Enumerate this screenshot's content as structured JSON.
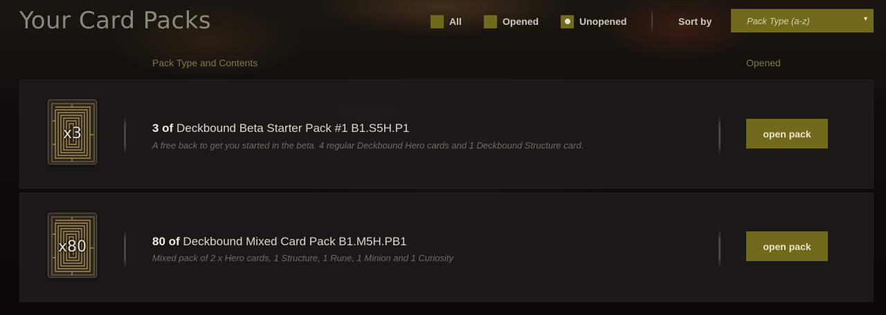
{
  "header": {
    "title": "Your Card Packs",
    "filters": [
      {
        "label": "All",
        "selected": false
      },
      {
        "label": "Opened",
        "selected": false
      },
      {
        "label": "Unopened",
        "selected": true
      }
    ],
    "sort_label": "Sort by",
    "sort_value": "Pack Type (a-z)"
  },
  "columns": {
    "pack_type": "Pack Type and Contents",
    "opened": "Opened"
  },
  "packs": [
    {
      "count_badge": "x3",
      "quantity": "3 of",
      "name": "Deckbound Beta Starter Pack #1 B1.S5H.P1",
      "description": "A free back to get you started in the beta. 4 regular Deckbound Hero cards and 1 Deckbound Structure card.",
      "button_label": "open pack"
    },
    {
      "count_badge": "x80",
      "quantity": "80 of",
      "name": "Deckbound Mixed Card Pack B1.M5H.PB1",
      "description": "Mixed pack of 2 x Hero cards, 1 Structure, 1 Rune, 1 Minion and 1 Curiosity",
      "button_label": "open pack"
    }
  ],
  "colors": {
    "accent": "#706a1a",
    "column_header": "#7d7a3d",
    "title": "#8a877b"
  }
}
